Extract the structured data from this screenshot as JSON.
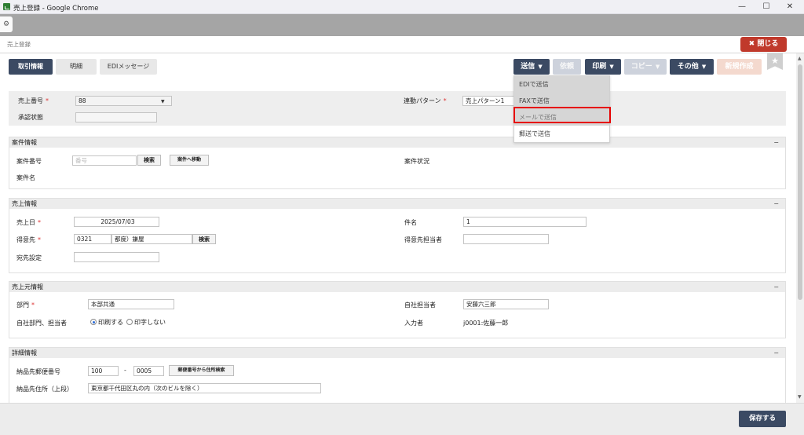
{
  "window": {
    "title": "売上登録 - Google Chrome",
    "minimize": "—",
    "maximize": "☐",
    "close": "✕"
  },
  "page": {
    "title": "売上登録",
    "close_label": "✖ 閉じる"
  },
  "tabs": [
    {
      "label": "取引情報"
    },
    {
      "label": "明細"
    },
    {
      "label": "EDIメッセージ"
    }
  ],
  "toolbar": {
    "send": "送信",
    "request": "依頼",
    "print": "印刷",
    "copy": "コピー",
    "other": "その他",
    "new": "新規作成",
    "caret": "▼"
  },
  "send_menu": [
    "EDIで送信",
    "FAXで送信",
    "メールで送信",
    "郵送で送信"
  ],
  "header_section": {
    "sales_no_label": "売上番号",
    "sales_no_value": "88",
    "approval_label": "承認状態",
    "approval_value": "",
    "link_pattern_label": "連動パターン",
    "link_pattern_value": "売上パターン1"
  },
  "anken": {
    "title": "案件情報",
    "no_label": "案件番号",
    "no_placeholder": "番号",
    "search_button": "検索",
    "goto_button": "案件へ移動",
    "name_label": "案件名",
    "status_label": "案件状況"
  },
  "sales_info": {
    "title": "売上情報",
    "date_label": "売上日",
    "date_value": "2025/07/03",
    "customer_label": "得意先",
    "customer_code": "0321",
    "customer_name": "都度）鎌屋",
    "search_button": "検索",
    "dest_label": "宛先設定",
    "subject_label": "件名",
    "subject_value": "1",
    "contact_label": "得意先担当者",
    "contact_value": ""
  },
  "origin_info": {
    "title": "売上元情報",
    "dept_label": "部門",
    "dept_value": "本部共通",
    "print_label": "自社部門、担当者",
    "print_yes": "印刷する",
    "print_no": "印字しない",
    "staff_label": "自社担当者",
    "staff_value": "安藤六三郎",
    "entered_label": "入力者",
    "entered_value": "j0001:佐藤一郎"
  },
  "detail_info": {
    "title": "詳細情報",
    "zip_label": "納品先郵便番号",
    "zip1": "100",
    "zip_dash": "-",
    "zip2": "0005",
    "zip_search_button": "郵便番号から住所検索",
    "addr_label": "納品先住所（上段）",
    "addr_value": "東京都千代田区丸の内（次のビルを除く）"
  },
  "footer": {
    "save": "保存する"
  },
  "colors": {
    "primary": "#3b4a63",
    "danger": "#c0392b",
    "highlight": "#e60000"
  }
}
